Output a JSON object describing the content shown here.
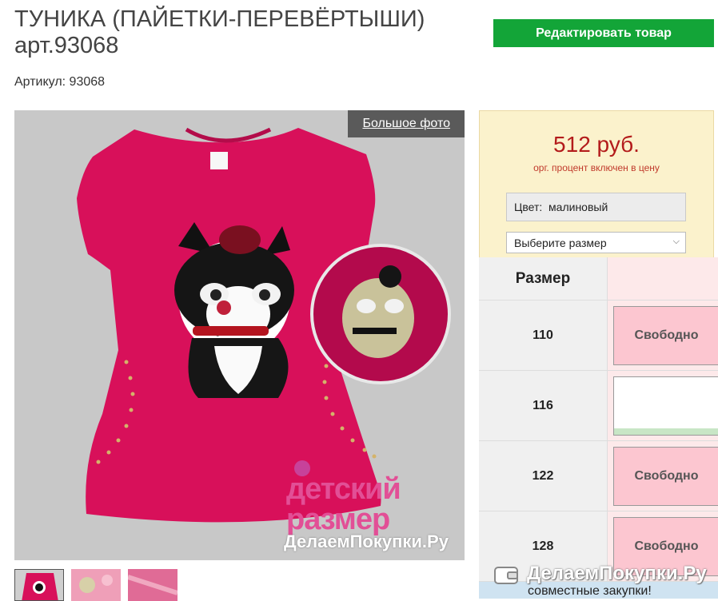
{
  "product": {
    "title": "ТУНИКА (ПАЙЕТКИ-ПЕРЕВЁРТЫШИ) арт.93068",
    "sku_line": "Артикул: 93068"
  },
  "actions": {
    "edit_label": "Редактировать товар",
    "big_photo_label": "Большое фото"
  },
  "photo": {
    "watermark_brand_line1": "детский",
    "watermark_brand_line2": "размер",
    "watermark_site": "ДелаемПокупки.Ру"
  },
  "pricing": {
    "price": "512 руб.",
    "note": "орг. процент включен в цену",
    "color_label": "Цвет:",
    "color_value": "малиновый",
    "size_select_placeholder": "Выберите размер"
  },
  "sizes": {
    "header": "Размер",
    "rows": [
      {
        "size": "110",
        "status": "Свободно"
      },
      {
        "size": "116",
        "status": ""
      },
      {
        "size": "122",
        "status": "Свободно"
      },
      {
        "size": "128",
        "status": "Свободно"
      }
    ]
  },
  "footer": {
    "brand": "ДелаемПокупки.Ру",
    "tagline": "совместные закупки!"
  },
  "colors": {
    "edit_button": "#13a538",
    "price": "#b31b1b",
    "shirt": "#d8105a",
    "status_free": "#fcc6d0"
  }
}
